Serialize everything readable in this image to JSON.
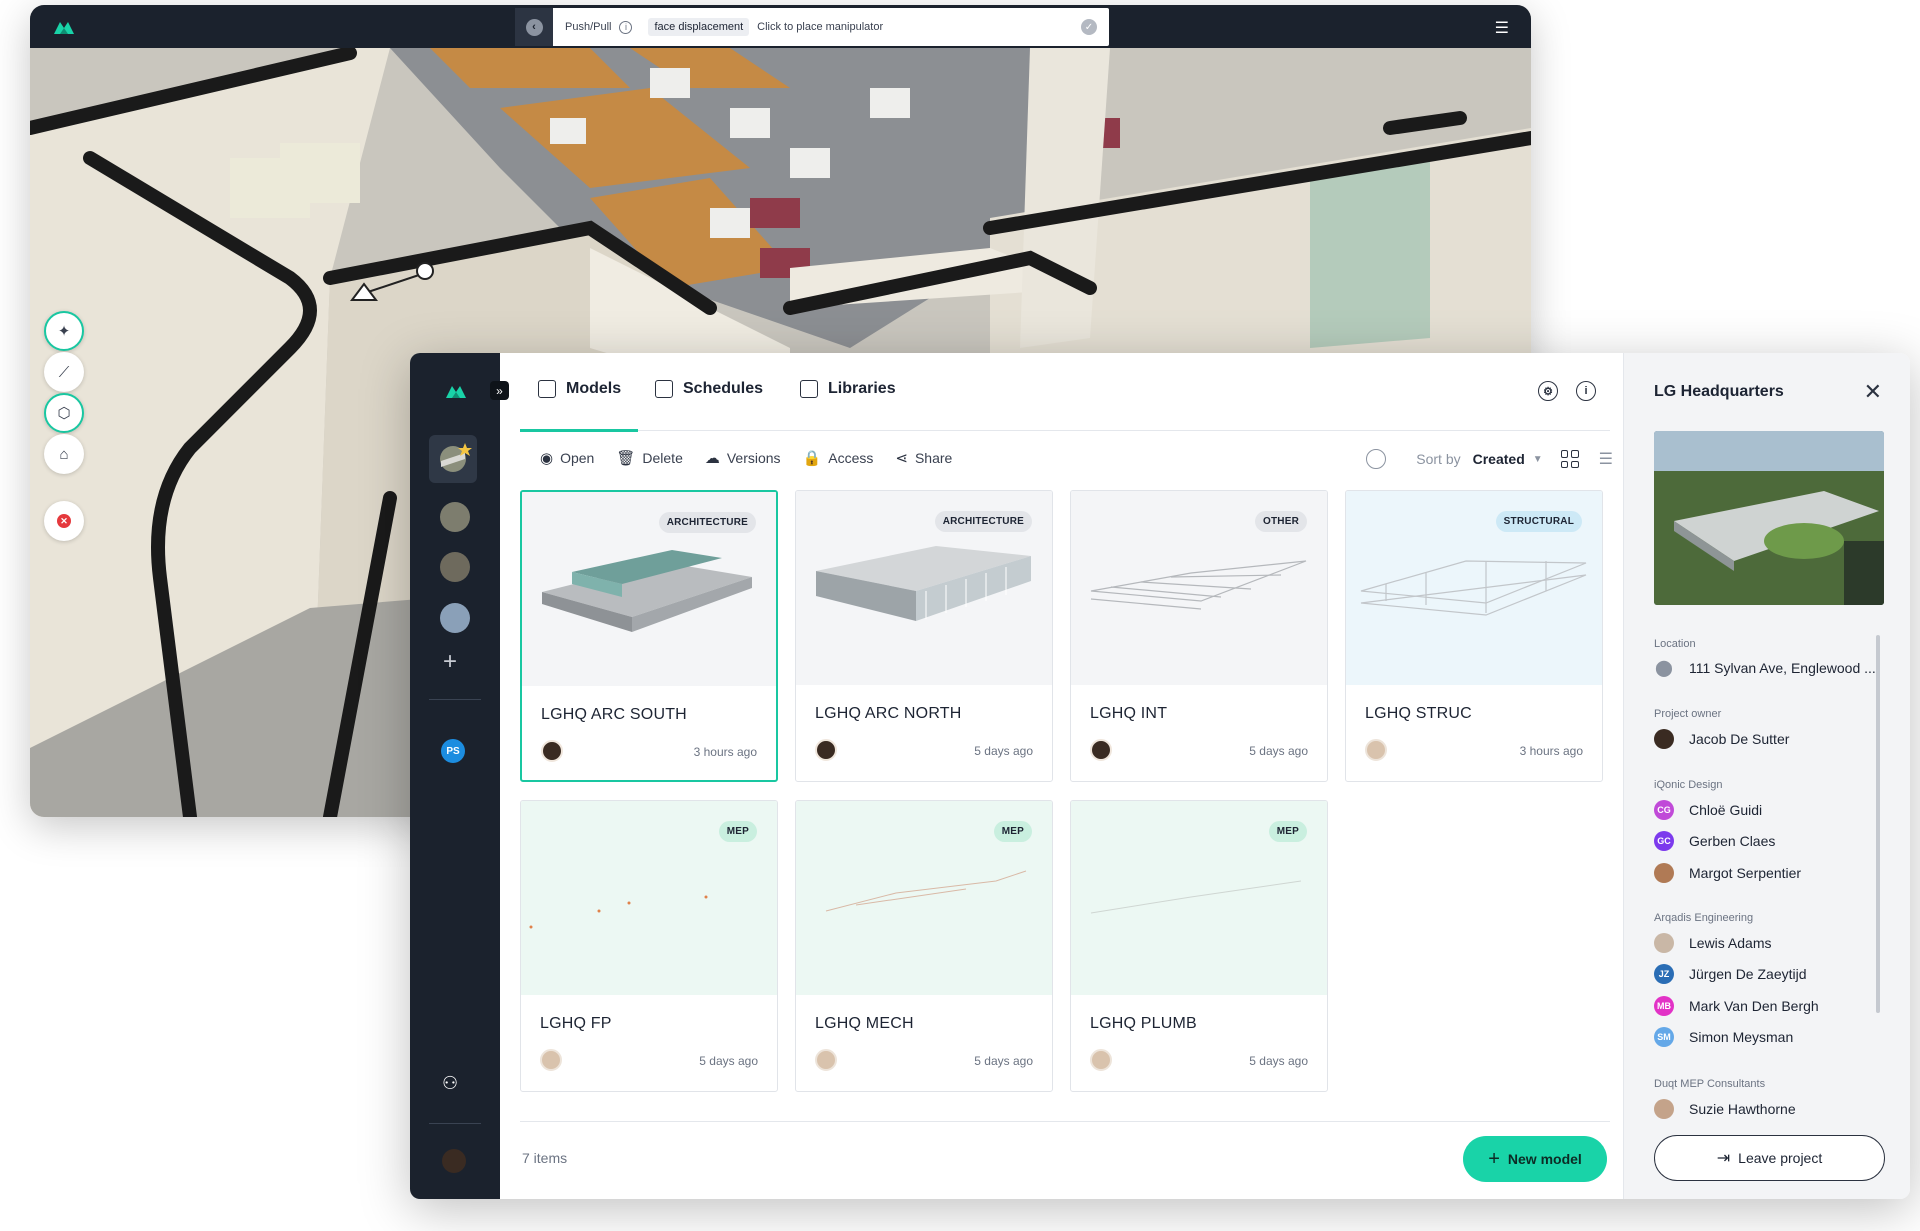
{
  "viewer": {
    "manipulator_mode": "Push/Pull",
    "manipulator_chip": "face displacement",
    "manipulator_hint": "Click to place manipulator",
    "icons": [
      "brand-logo-icon",
      "back-icon",
      "info-icon",
      "check-icon",
      "sliders-icon",
      "select-cursor-icon",
      "measure-icon",
      "cube-icon",
      "section-icon",
      "close-icon"
    ]
  },
  "rail": {
    "user_initials": "PS",
    "projects": [
      "project-1",
      "project-2",
      "project-3",
      "project-4"
    ]
  },
  "tabs": [
    {
      "label": "Models",
      "icon": "cube-icon"
    },
    {
      "label": "Schedules",
      "icon": "table-icon"
    },
    {
      "label": "Libraries",
      "icon": "library-icon"
    }
  ],
  "toolbar": {
    "open": "Open",
    "delete": "Delete",
    "versions": "Versions",
    "access": "Access",
    "share": "Share",
    "sort_label": "Sort by",
    "sort_value": "Created"
  },
  "models": [
    {
      "name": "LGHQ ARC SOUTH",
      "badge": "ARCHITECTURE",
      "time": "3 hours ago",
      "selected": true
    },
    {
      "name": "LGHQ ARC NORTH",
      "badge": "ARCHITECTURE",
      "time": "5 days ago"
    },
    {
      "name": "LGHQ INT",
      "badge": "OTHER",
      "time": "5 days ago"
    },
    {
      "name": "LGHQ STRUC",
      "badge": "STRUCTURAL",
      "time": "3 hours ago"
    },
    {
      "name": "LGHQ FP",
      "badge": "MEP",
      "time": "5 days ago"
    },
    {
      "name": "LGHQ MECH",
      "badge": "MEP",
      "time": "5 days ago"
    },
    {
      "name": "LGHQ PLUMB",
      "badge": "MEP",
      "time": "5 days ago"
    }
  ],
  "footer": {
    "count": "7 items",
    "new_model": "New model"
  },
  "side": {
    "title": "LG Headquarters",
    "location_label": "Location",
    "location": "111 Sylvan Ave, Englewood ...",
    "owner_label": "Project owner",
    "owner": "Jacob De Sutter",
    "groups": [
      {
        "label": "iQonic Design",
        "members": [
          {
            "name": "Chloë Guidi",
            "initials": "CG",
            "color": "#c04ad8"
          },
          {
            "name": "Gerben Claes",
            "initials": "GC",
            "color": "#7c3aed"
          },
          {
            "name": "Margot Serpentier",
            "initials": "",
            "color": "#b07a55"
          }
        ]
      },
      {
        "label": "Arqadis Engineering",
        "members": [
          {
            "name": "Lewis Adams",
            "initials": "",
            "color": "#c9b7a6"
          },
          {
            "name": "Jürgen De Zaeytijd",
            "initials": "JZ",
            "color": "#2a6db5"
          },
          {
            "name": "Mark Van Den Bergh",
            "initials": "MB",
            "color": "#e232c6"
          },
          {
            "name": "Simon Meysman",
            "initials": "SM",
            "color": "#64a8e8"
          }
        ]
      },
      {
        "label": "Duqt MEP Consultants",
        "members": [
          {
            "name": "Suzie Hawthorne",
            "initials": "",
            "color": "#c4a38a"
          }
        ]
      }
    ],
    "leave": "Leave project"
  },
  "colors": {
    "accent": "#19c7a1",
    "rail": "#1b222d"
  }
}
